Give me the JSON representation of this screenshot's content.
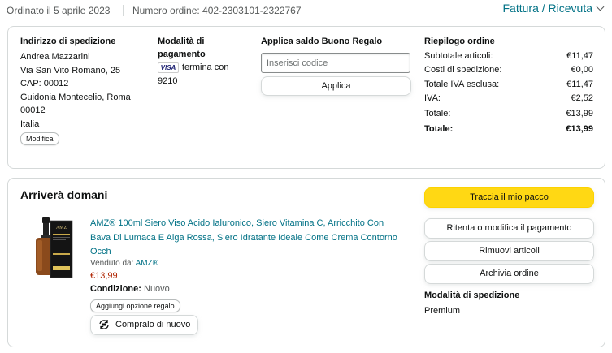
{
  "header": {
    "ordered_on": "Ordinato il 5 aprile 2023",
    "order_number": "Numero ordine: 402-2303101-2322767",
    "invoice_label": "Fattura / Ricevuta"
  },
  "shipping": {
    "title": "Indirizzo di spedizione",
    "name": "Andrea Mazzarini",
    "street": "Via San Vito Romano, 25",
    "cap": "CAP: 00012",
    "city_line1": "Guidonia Montecelio, Roma",
    "city_line2": "00012",
    "country": "Italia",
    "edit_label": "Modifica"
  },
  "payment": {
    "title_line1": "Modalità di",
    "title_line2": "pagamento",
    "card_brand": "VISA",
    "ends_with_line1": "termina con",
    "ends_with_line2": "9210"
  },
  "gift_card": {
    "title": "Applica saldo Buono Regalo",
    "placeholder": "Inserisci codice",
    "apply_label": "Applica"
  },
  "summary": {
    "title": "Riepilogo ordine",
    "rows": [
      {
        "label": "Subtotale articoli:",
        "value": "€11,47"
      },
      {
        "label": "Costi di spedizione:",
        "value": "€0,00"
      },
      {
        "label": "Totale IVA esclusa:",
        "value": "€11,47"
      },
      {
        "label": "IVA:",
        "value": "€2,52"
      },
      {
        "label": "Totale:",
        "value": "€13,99"
      }
    ],
    "grand_total_label": "Totale:",
    "grand_total_value": "€13,99"
  },
  "delivery": {
    "status": "Arriverà domani",
    "product": {
      "title_line1": "AMZ® 100ml Siero Viso Acido Ialuronico, Siero Vitamina C, Arricchito Con",
      "title_line2": "Bava Di Lumaca E Alga Rossa, Siero Idratante Ideale Come Crema Contorno",
      "title_line3": "Occh",
      "sold_by_label": "Venduto da: ",
      "seller": "AMZ®",
      "price": "€13,99",
      "condition_label": "Condizione:",
      "condition_value": "Nuovo",
      "gift_option_label": "Aggiungi opzione regalo",
      "buy_again_label": "Compralo di nuovo",
      "image_label": "AMZ"
    },
    "actions": {
      "track": "Traccia il mio pacco",
      "retry_payment": "Ritenta o modifica il pagamento",
      "remove_items": "Rimuovi articoli",
      "archive": "Archivia ordine"
    },
    "shipping_mode_title": "Modalità di spedizione",
    "shipping_mode_value": "Premium"
  },
  "colors": {
    "link": "#007185",
    "price": "#b12704",
    "primary_button": "#ffd814",
    "border": "#d5d9d9"
  }
}
